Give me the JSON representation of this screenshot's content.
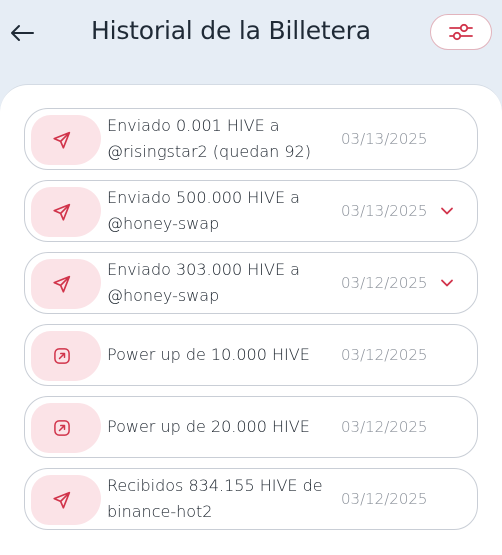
{
  "header": {
    "title": "Historial de la Billetera",
    "back_icon": "arrow-left-icon",
    "filter_icon": "sliders-icon"
  },
  "colors": {
    "accent": "#d1344b",
    "icon_tile": "#fbe3e7",
    "header_bg": "#e6edf5"
  },
  "transactions": [
    {
      "description": "Enviado 0.001 HIVE a @risingstar2 (quedan 92)",
      "date": "03/13/2025",
      "icon": "send-icon",
      "expandable": false
    },
    {
      "description": "Enviado 500.000 HIVE a @honey-swap",
      "date": "03/13/2025",
      "icon": "send-icon",
      "expandable": true
    },
    {
      "description": "Enviado 303.000 HIVE a @honey-swap",
      "date": "03/12/2025",
      "icon": "send-icon",
      "expandable": true
    },
    {
      "description": "Power up de 10.000 HIVE",
      "date": "03/12/2025",
      "icon": "power-up-icon",
      "expandable": false
    },
    {
      "description": "Power up de 20.000 HIVE",
      "date": "03/12/2025",
      "icon": "power-up-icon",
      "expandable": false
    },
    {
      "description": "Recibidos 834.155 HIVE de binance-hot2",
      "date": "03/12/2025",
      "icon": "send-icon",
      "expandable": false
    }
  ]
}
